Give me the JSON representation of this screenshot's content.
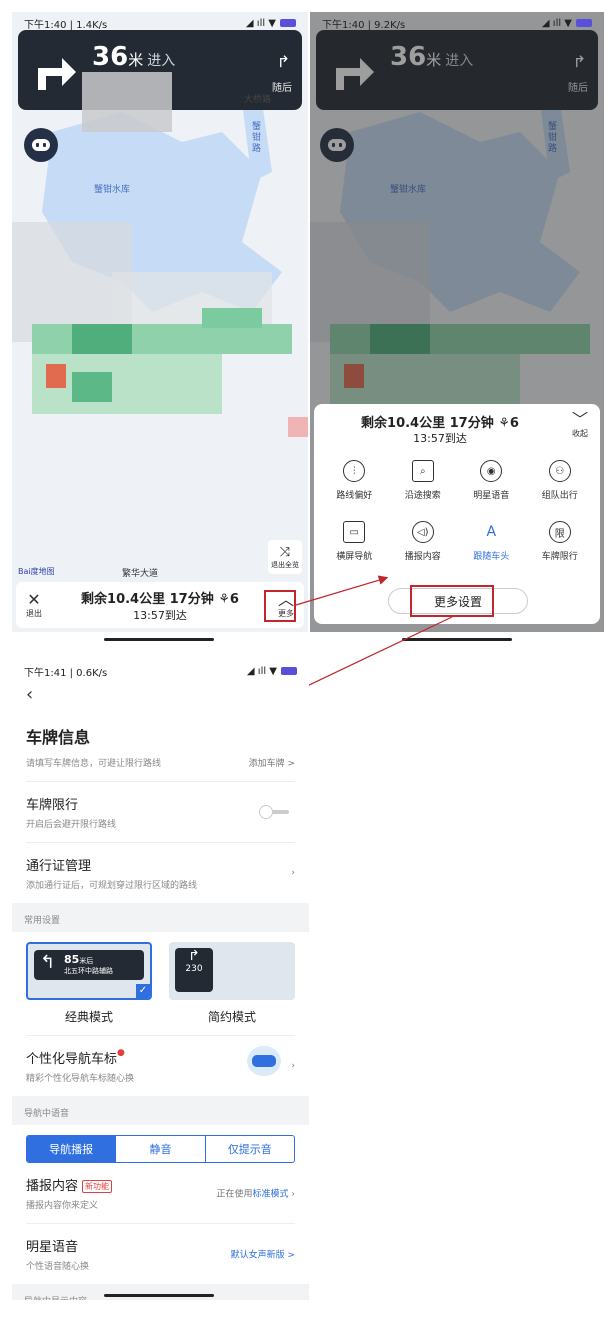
{
  "status1": {
    "time": "下午1:40 | 1.4K/s"
  },
  "status2": {
    "time": "下午1:40 | 9.2K/s"
  },
  "status3": {
    "time": "下午1:41 | 0.6K/s"
  },
  "guide": {
    "distance": "36",
    "unit": "米",
    "enter": "进入",
    "next_label": "随后"
  },
  "map": {
    "reservoir": "蟹钳水库",
    "road_v": "蟹钳路",
    "road_top": "大桥路",
    "road_bottom": "繁华大道",
    "baidu": "Bai度地图"
  },
  "nav": {
    "exit_label": "退出",
    "more_label": "更多",
    "collapse_label": "收起",
    "remaining": "剩余10.4公里 17分钟 ⚘6",
    "arrival": "13:57到达",
    "overview_label": "退出全览"
  },
  "more_panel": {
    "items": [
      {
        "label": "路线偏好",
        "glyph": "⫶"
      },
      {
        "label": "沿途搜索",
        "glyph": "⌕"
      },
      {
        "label": "明星语音",
        "glyph": "◉"
      },
      {
        "label": "组队出行",
        "glyph": "⚇"
      },
      {
        "label": "横屏导航",
        "glyph": "▭"
      },
      {
        "label": "播报内容",
        "glyph": "◁)"
      },
      {
        "label": "跟随车头",
        "glyph": "A"
      },
      {
        "label": "车牌限行",
        "glyph": "限"
      }
    ],
    "more_settings": "更多设置"
  },
  "settings": {
    "plate_title": "车牌信息",
    "plate_sub": "请填写车牌信息，可避让限行路线",
    "plate_add": "添加车牌 >",
    "limit_title": "车牌限行",
    "limit_sub": "开启后会避开限行路线",
    "pass_title": "通行证管理",
    "pass_sub": "添加通行证后，可规划穿过限行区域的路线",
    "common_section": "常用设置",
    "mode_classic": "经典模式",
    "mode_simple": "简约模式",
    "classic_dist": "85",
    "classic_unit": "米后",
    "classic_road": "北五环中路辅路",
    "simple_dist": "230",
    "icon_title": "个性化导航车标",
    "icon_sub": "精彩个性化导航车标随心换",
    "voice_section": "导航中语音",
    "seg": [
      "导航播报",
      "静音",
      "仅提示音"
    ],
    "broadcast_title": "播报内容",
    "broadcast_badge": "新功能",
    "broadcast_sub": "播报内容你来定义",
    "broadcast_prefix": "正在使用",
    "broadcast_mode": "标准模式",
    "star_title": "明星语音",
    "star_sub": "个性语音随心换",
    "star_value": "默认女声新版 >",
    "display_section": "导航中显示内容"
  },
  "colors": {
    "accent": "#2f6fe0",
    "annotation": "#c0262d",
    "guide_bg": "#242a33"
  }
}
